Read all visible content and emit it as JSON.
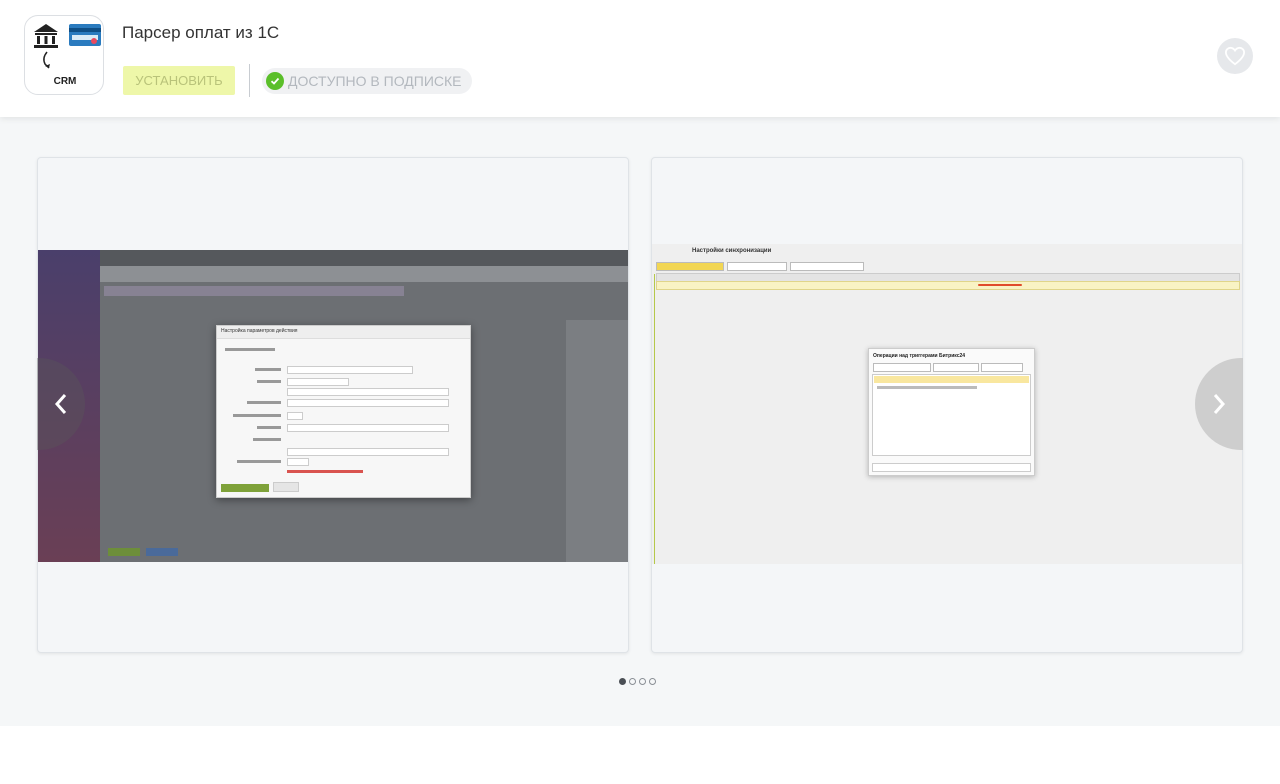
{
  "app": {
    "title": "Парсер оплат из 1С",
    "icon_label": "CRM",
    "install_label": "УСТАНОВИТЬ",
    "availability_label": "ДОСТУПНО В ПОДПИСКЕ"
  },
  "gallery": {
    "slides": [
      {
        "dialog_title": "Настройка параметров действия"
      },
      {
        "window_title": "Настройки синхронизации",
        "dialog_title": "Операции над триггерами Битрикс24"
      }
    ],
    "page_count": 4,
    "active_index": 0
  },
  "colors": {
    "install_bg": "#eef7a9",
    "check_green": "#5bbf2a",
    "gallery_bg": "#f5f7f8"
  },
  "icons": {
    "favorite": "heart-icon",
    "prev": "chevron-left-icon",
    "next": "chevron-right-icon",
    "available": "check-circle-icon"
  }
}
